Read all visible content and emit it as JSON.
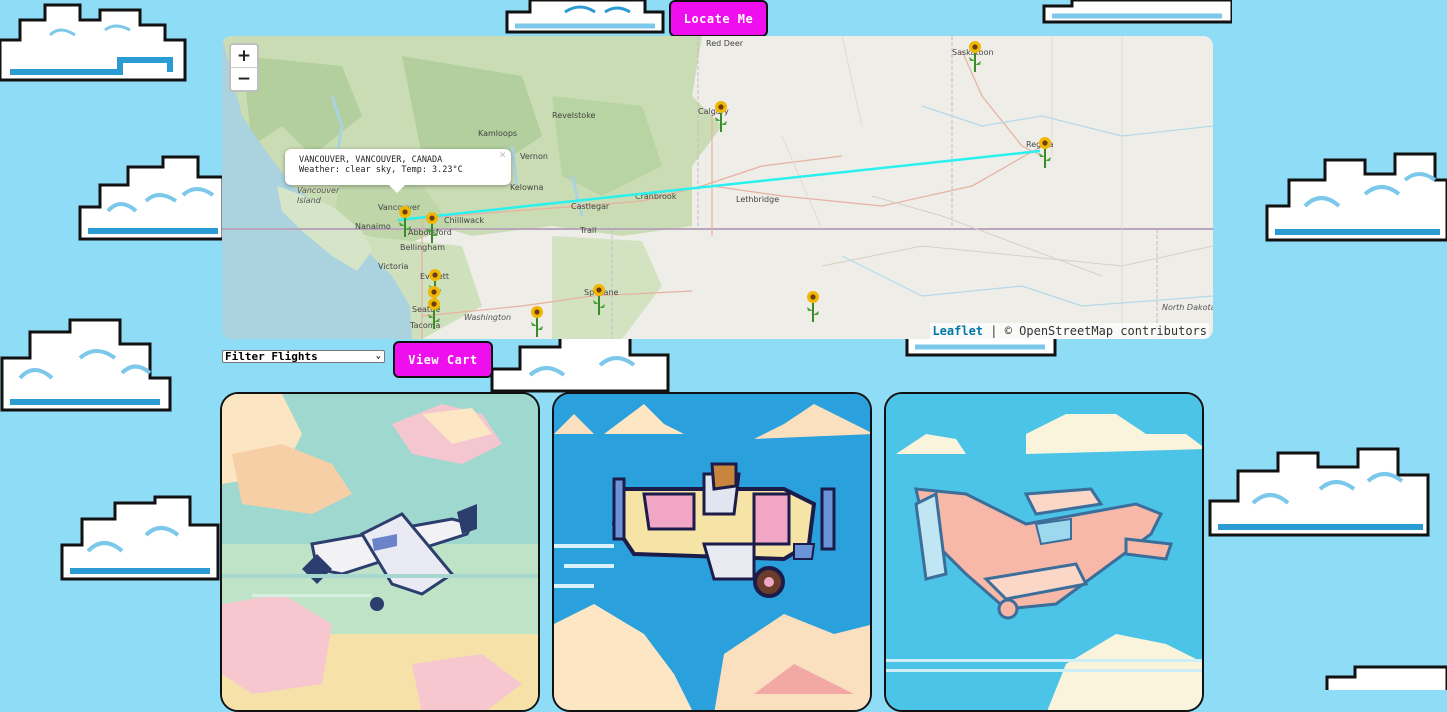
{
  "buttons": {
    "locate": "Locate Me",
    "view_cart": "View Cart"
  },
  "map": {
    "zoom_in": "+",
    "zoom_out": "−",
    "popup": {
      "title": "VANCOUVER, VANCOUVER, CANADA",
      "weather": "Weather: clear sky, Temp: 3.23°C",
      "close": "×"
    },
    "attribution": {
      "leaflet": "Leaflet",
      "separator": " | © ",
      "osm": "OpenStreetMap contributors"
    },
    "route_color": "#2af0ee",
    "labels": {
      "red_deer": "Red Deer",
      "saskatoon": "Saskatoon",
      "calgary": "Calgary",
      "revelstoke": "Revelstoke",
      "kamloops": "Kamloops",
      "vernon": "Vernon",
      "kelowna": "Kelowna",
      "vancouver_island": "Vancouver Island",
      "vancouver": "Vancouver",
      "nanaimo": "Nanaimo",
      "abbotsford": "Abbotsford",
      "chilliwack": "Chilliwack",
      "bellingham": "Bellingham",
      "victoria": "Victoria",
      "castlegar": "Castlegar",
      "cranbrook": "Cranbrook",
      "lethbridge": "Lethbridge",
      "trail": "Trail",
      "regina": "Regina",
      "everett": "Everett",
      "seattle": "Seattle",
      "tacoma": "Tacoma",
      "washington": "Washington",
      "spokane": "Spokane",
      "north_dakota": "North Dakota"
    }
  },
  "filter": {
    "selected": "Filter Flights"
  },
  "cards": [
    {
      "name": "plane-card-1"
    },
    {
      "name": "plane-card-2"
    },
    {
      "name": "plane-card-3"
    }
  ],
  "colors": {
    "accent": "#ee0eee",
    "sky": "#8edcf5"
  }
}
